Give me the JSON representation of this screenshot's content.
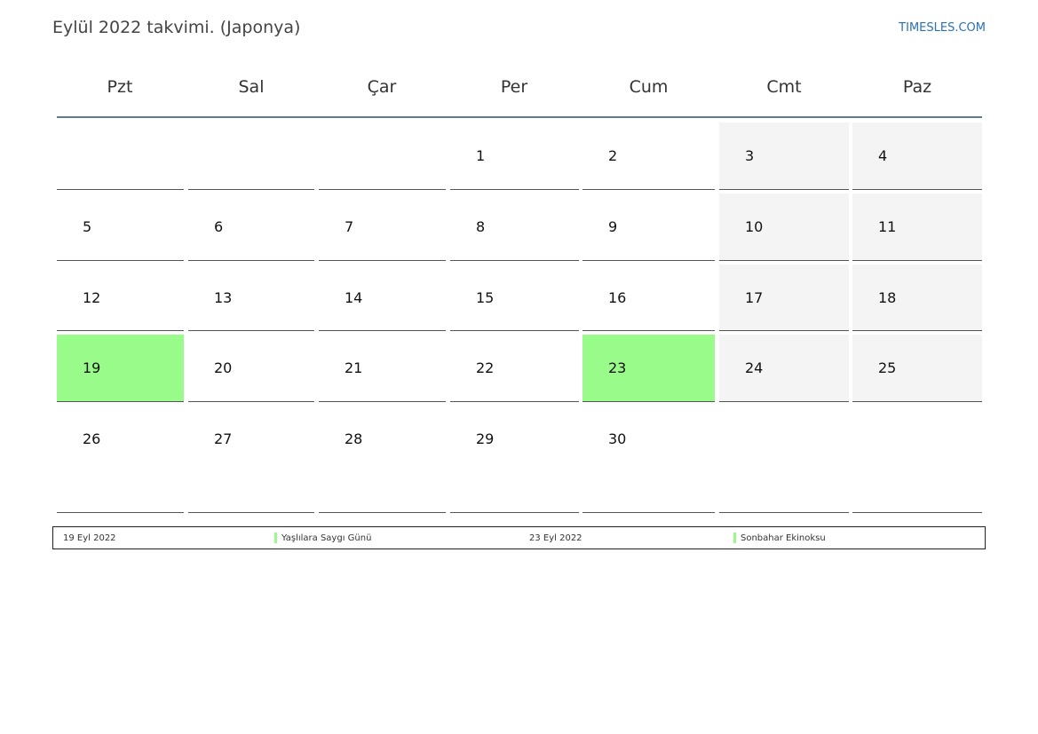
{
  "header": {
    "title": "Eylül 2022 takvimi. (Japonya)",
    "site": "TIMESLES.COM"
  },
  "weekdays": [
    "Pzt",
    "Sal",
    "Çar",
    "Per",
    "Cum",
    "Cmt",
    "Paz"
  ],
  "weeks": [
    [
      "",
      "",
      "",
      "1",
      "2",
      "3",
      "4"
    ],
    [
      "5",
      "6",
      "7",
      "8",
      "9",
      "10",
      "11"
    ],
    [
      "12",
      "13",
      "14",
      "15",
      "16",
      "17",
      "18"
    ],
    [
      "19",
      "20",
      "21",
      "22",
      "23",
      "24",
      "25"
    ],
    [
      "26",
      "27",
      "28",
      "29",
      "30",
      "",
      ""
    ]
  ],
  "holiday_days": [
    "19",
    "23"
  ],
  "colors": {
    "holiday": "#98fb8a",
    "weekend": "#f4f4f4",
    "header_rule": "#5d7a9a",
    "link": "#2a70b8"
  },
  "legend": [
    {
      "date": "19 Eyl 2022",
      "name": "Yaşlılara Saygı Günü"
    },
    {
      "date": "23 Eyl 2022",
      "name": "Sonbahar Ekinoksu"
    }
  ]
}
